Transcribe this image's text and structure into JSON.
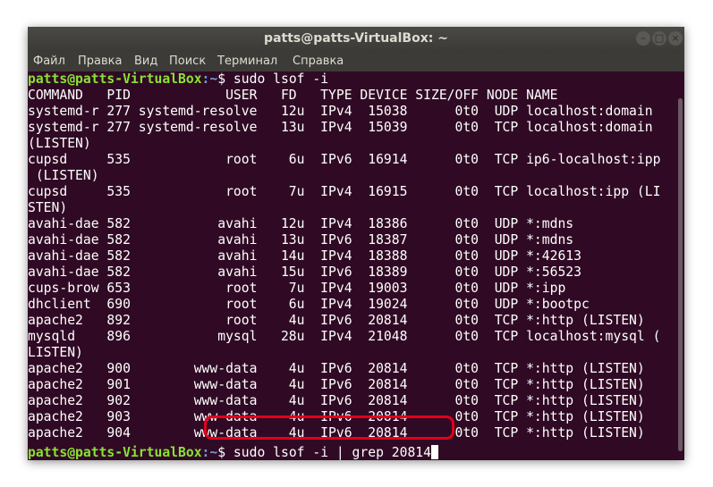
{
  "window": {
    "title": "patts@patts-VirtualBox: ~",
    "buttons": {
      "minimize": "–",
      "maximize": "□",
      "close": "×"
    }
  },
  "menu": [
    "Файл",
    "Правка",
    "Вид",
    "Поиск",
    "Терминал",
    "Справка"
  ],
  "prompt": {
    "user": "patts@patts-VirtualBox",
    "path": ":~",
    "symbol": "$ "
  },
  "terminal": {
    "command1": "sudo lsof -i",
    "output": [
      "COMMAND   PID            USER   FD   TYPE DEVICE SIZE/OFF NODE NAME",
      "systemd-r 277 systemd-resolve   12u  IPv4  15038      0t0  UDP localhost:domain",
      "systemd-r 277 systemd-resolve   13u  IPv4  15039      0t0  TCP localhost:domain",
      "(LISTEN)",
      "cupsd     535            root    6u  IPv6  16914      0t0  TCP ip6-localhost:ipp",
      " (LISTEN)",
      "cupsd     535            root    7u  IPv4  16915      0t0  TCP localhost:ipp (LI",
      "STEN)",
      "avahi-dae 582           avahi   12u  IPv4  18386      0t0  UDP *:mdns",
      "avahi-dae 582           avahi   13u  IPv6  18387      0t0  UDP *:mdns",
      "avahi-dae 582           avahi   14u  IPv4  18388      0t0  UDP *:42613",
      "avahi-dae 582           avahi   15u  IPv6  18389      0t0  UDP *:56523",
      "cups-brow 653            root    7u  IPv4  19003      0t0  UDP *:ipp",
      "dhclient  690            root    6u  IPv4  19024      0t0  UDP *:bootpc",
      "apache2   892            root    4u  IPv6  20814      0t0  TCP *:http (LISTEN)",
      "mysqld    896           mysql   28u  IPv4  21048      0t0  TCP localhost:mysql (",
      "LISTEN)",
      "apache2   900        www-data    4u  IPv6  20814      0t0  TCP *:http (LISTEN)",
      "apache2   901        www-data    4u  IPv6  20814      0t0  TCP *:http (LISTEN)",
      "apache2   902        www-data    4u  IPv6  20814      0t0  TCP *:http (LISTEN)",
      "apache2   903        www-data    4u  IPv6  20814      0t0  TCP *:http (LISTEN)",
      "apache2   904        www-data    4u  IPv6  20814      0t0  TCP *:http (LISTEN)"
    ],
    "command2": "sudo lsof -i | grep 20814"
  },
  "colors": {
    "background": "#300a24",
    "prompt_user": "#8ae234",
    "prompt_path": "#729fcf",
    "highlight": "#e3001b"
  }
}
